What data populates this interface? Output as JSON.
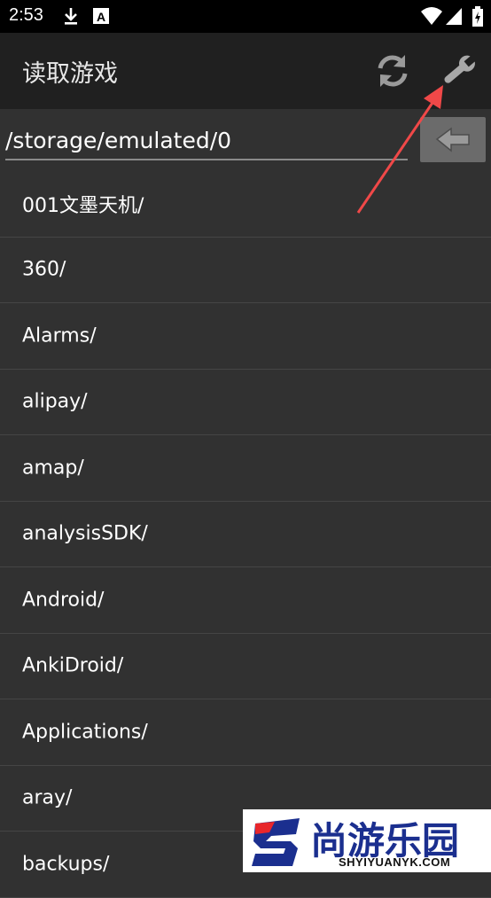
{
  "status_bar": {
    "time": "2:53",
    "left_icons": [
      "download-icon",
      "a-badge-icon"
    ],
    "right_icons": [
      "wifi-icon",
      "signal-icon",
      "battery-icon"
    ]
  },
  "app_bar": {
    "title": "读取游戏",
    "actions": [
      "refresh-icon",
      "wrench-icon"
    ]
  },
  "path_bar": {
    "value": "/storage/emulated/0",
    "back_icon": "back-arrow-icon"
  },
  "files": [
    {
      "name": "001文墨天机/"
    },
    {
      "name": "360/"
    },
    {
      "name": "Alarms/"
    },
    {
      "name": "alipay/"
    },
    {
      "name": "amap/"
    },
    {
      "name": "analysisSDK/"
    },
    {
      "name": "Android/"
    },
    {
      "name": "AnkiDroid/"
    },
    {
      "name": "Applications/"
    },
    {
      "name": "aray/"
    },
    {
      "name": "backups/"
    }
  ],
  "annotation": {
    "color": "#f04848"
  },
  "watermark": {
    "text": "尚游乐园",
    "subtext": "SHYIYUANYK.COM"
  },
  "colors": {
    "background": "#313131",
    "app_bar": "#202020",
    "status_bar": "#000000",
    "divider": "#454545",
    "back_button": "#6b6b6b"
  }
}
